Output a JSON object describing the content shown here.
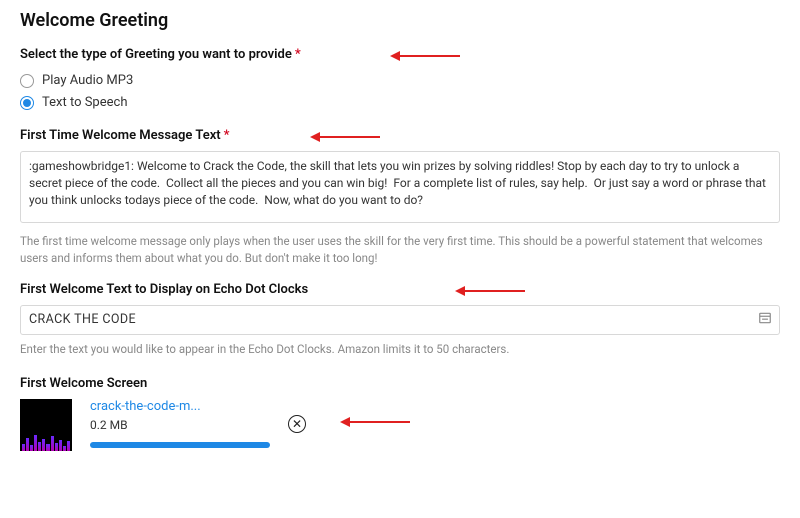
{
  "title": "Welcome Greeting",
  "greeting_type": {
    "label": "Select the type of Greeting you want to provide",
    "required_mark": "*",
    "options": [
      {
        "label": "Play Audio MP3",
        "selected": false
      },
      {
        "label": "Text to Speech",
        "selected": true
      }
    ]
  },
  "first_message": {
    "label": "First Time Welcome Message Text",
    "required_mark": "*",
    "value": ":gameshowbridge1: Welcome to Crack the Code, the skill that lets you win prizes by solving riddles! Stop by each day to try to unlock a secret piece of the code.  Collect all the pieces and you can win big!  For a complete list of rules, say help.  Or just say a word or phrase that you think unlocks todays piece of the code.  Now, what do you want to do?",
    "help": "The first time welcome message only plays when the user uses the skill for the very first time. This should be a powerful statement that welcomes users and informs them about what you do. But don't make it too long!"
  },
  "echo_text": {
    "label": "First Welcome Text to Display on Echo Dot Clocks",
    "value": "CRACK THE CODE",
    "help": "Enter the text you would like to appear in the Echo Dot Clocks. Amazon limits it to 50 characters."
  },
  "welcome_screen": {
    "label": "First Welcome Screen",
    "file": {
      "name": "crack-the-code-m...",
      "size": "0.2 MB"
    }
  }
}
